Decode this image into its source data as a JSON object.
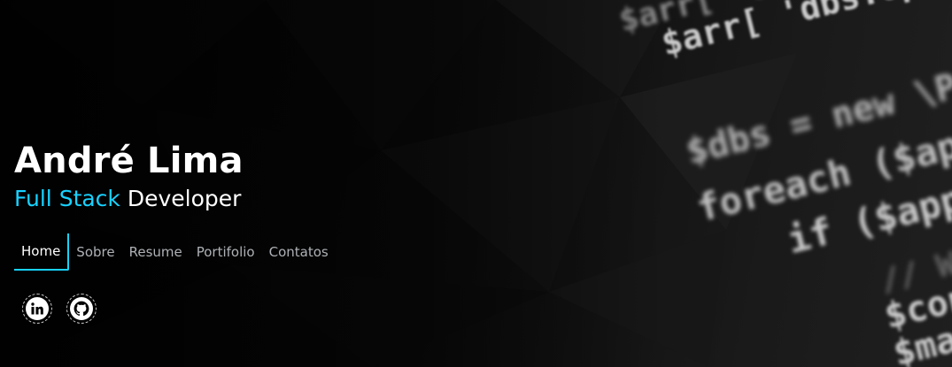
{
  "hero": {
    "name": "André Lima",
    "subtitle_accent": "Full Stack",
    "subtitle_rest": "Developer",
    "accent_color": "#18d2ff"
  },
  "nav": {
    "items": [
      {
        "label": "Home",
        "active": true
      },
      {
        "label": "Sobre",
        "active": false
      },
      {
        "label": "Resume",
        "active": false
      },
      {
        "label": "Portifolio",
        "active": false
      },
      {
        "label": "Contatos",
        "active": false
      }
    ]
  },
  "socials": [
    {
      "icon": "linkedin-icon"
    },
    {
      "icon": "github-icon"
    }
  ],
  "background_code": [
    "$arr[ 'dbs' ]",
    "$arr[ 'dbs.optio",
    "$dbs = new \\Pi",
    "foreach ($app",
    "if ($app[",
    "// W",
    "$con",
    "$ma"
  ]
}
